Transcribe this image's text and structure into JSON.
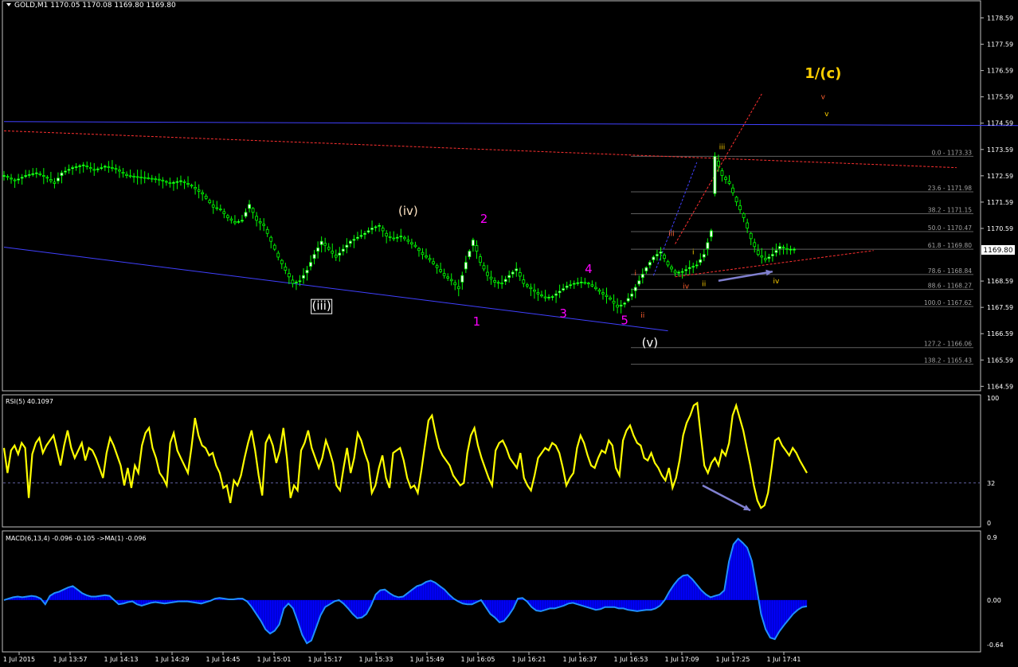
{
  "window": {
    "header": "GOLD,M1  1170.05 1170.08 1169.80 1169.80",
    "current_price": "1169.80"
  },
  "colors": {
    "background": "#000000",
    "frame": "#c0c0c0",
    "candle": "#00ff00",
    "candle_body": "#ffffff",
    "rsi": "#ffff00",
    "macd_hist": "#0000ff",
    "macd_line": "#1e90ff",
    "trend_blue": "#4040ff",
    "trend_red": "#ff3030",
    "fib": "#606060",
    "wave_magenta": "#ff00ff",
    "wave_white": "#ffffff",
    "wave_yellow": "#ffd000",
    "arrow": "#8080d0"
  },
  "chart_data": [
    {
      "type": "line",
      "title": "GOLD,M1",
      "ohlc": {
        "open": 1170.05,
        "high": 1170.08,
        "low": 1169.8,
        "close": 1169.8
      },
      "ylim": [
        1164.59,
        1178.59
      ],
      "y_ticks": [
        "1178.59",
        "1177.59",
        "1176.59",
        "1175.59",
        "1174.59",
        "1173.59",
        "1172.59",
        "1171.59",
        "1170.59",
        "1169.80",
        "1168.59",
        "1167.59",
        "1166.59",
        "1165.59",
        "1164.59"
      ],
      "x_ticks": [
        "1 Jul 2015",
        "1 Jul 13:57",
        "1 Jul 14:13",
        "1 Jul 14:29",
        "1 Jul 14:45",
        "1 Jul 15:01",
        "1 Jul 15:17",
        "1 Jul 15:33",
        "1 Jul 15:49",
        "1 Jul 16:05",
        "1 Jul 16:21",
        "1 Jul 16:37",
        "1 Jul 16:53",
        "1 Jul 17:09",
        "1 Jul 17:25",
        "1 Jul 17:41"
      ],
      "price_path": [
        [
          0,
          1172.6
        ],
        [
          3,
          1172.4
        ],
        [
          6,
          1172.6
        ],
        [
          9,
          1172.7
        ],
        [
          12,
          1172.5
        ],
        [
          14,
          1172.3
        ],
        [
          16,
          1172.7
        ],
        [
          19,
          1172.9
        ],
        [
          22,
          1173.0
        ],
        [
          25,
          1172.8
        ],
        [
          28,
          1172.95
        ],
        [
          31,
          1172.85
        ],
        [
          34,
          1172.6
        ],
        [
          37,
          1172.55
        ],
        [
          40,
          1172.5
        ],
        [
          43,
          1172.45
        ],
        [
          46,
          1172.3
        ],
        [
          49,
          1172.4
        ],
        [
          52,
          1172.2
        ],
        [
          55,
          1171.9
        ],
        [
          58,
          1171.4
        ],
        [
          60,
          1171.3
        ],
        [
          62,
          1171.0
        ],
        [
          64,
          1170.8
        ],
        [
          66,
          1170.9
        ],
        [
          68,
          1171.5
        ],
        [
          70,
          1170.9
        ],
        [
          72,
          1170.7
        ],
        [
          74,
          1170.1
        ],
        [
          76,
          1169.5
        ],
        [
          78,
          1169.0
        ],
        [
          80,
          1168.5
        ],
        [
          82,
          1168.6
        ],
        [
          84,
          1169.0
        ],
        [
          86,
          1169.6
        ],
        [
          88,
          1170.1
        ],
        [
          90,
          1169.8
        ],
        [
          92,
          1169.5
        ],
        [
          94,
          1169.8
        ],
        [
          96,
          1170.1
        ],
        [
          98,
          1170.25
        ],
        [
          100,
          1170.4
        ],
        [
          102,
          1170.6
        ],
        [
          104,
          1170.7
        ],
        [
          106,
          1170.3
        ],
        [
          108,
          1170.2
        ],
        [
          110,
          1170.3
        ],
        [
          112,
          1170.1
        ],
        [
          114,
          1169.9
        ],
        [
          116,
          1169.6
        ],
        [
          118,
          1169.4
        ],
        [
          120,
          1169.1
        ],
        [
          122,
          1168.8
        ],
        [
          124,
          1168.6
        ],
        [
          126,
          1168.3
        ],
        [
          128,
          1169.3
        ],
        [
          130,
          1170.15
        ],
        [
          132,
          1169.3
        ],
        [
          134,
          1168.8
        ],
        [
          136,
          1168.55
        ],
        [
          138,
          1168.5
        ],
        [
          140,
          1168.8
        ],
        [
          142,
          1169.05
        ],
        [
          144,
          1168.5
        ],
        [
          146,
          1168.3
        ],
        [
          148,
          1168.1
        ],
        [
          150,
          1167.95
        ],
        [
          152,
          1168.0
        ],
        [
          154,
          1168.2
        ],
        [
          156,
          1168.4
        ],
        [
          158,
          1168.5
        ],
        [
          160,
          1168.55
        ],
        [
          162,
          1168.5
        ],
        [
          164,
          1168.3
        ],
        [
          166,
          1168.1
        ],
        [
          168,
          1167.9
        ],
        [
          170,
          1167.6
        ],
        [
          172,
          1167.75
        ],
        [
          174,
          1168.1
        ],
        [
          176,
          1168.6
        ],
        [
          178,
          1169.1
        ],
        [
          180,
          1169.5
        ],
        [
          182,
          1169.7
        ],
        [
          184,
          1169.2
        ],
        [
          186,
          1168.9
        ],
        [
          188,
          1168.95
        ],
        [
          190,
          1169.1
        ],
        [
          192,
          1169.2
        ],
        [
          194,
          1169.6
        ],
        [
          196,
          1170.5
        ],
        [
          197,
          1173.33
        ],
        [
          199,
          1172.6
        ],
        [
          201,
          1172.3
        ],
        [
          203,
          1171.6
        ],
        [
          205,
          1171.0
        ],
        [
          207,
          1170.2
        ],
        [
          209,
          1169.6
        ],
        [
          211,
          1169.4
        ],
        [
          213,
          1169.6
        ],
        [
          215,
          1169.9
        ],
        [
          217,
          1169.8
        ],
        [
          219,
          1169.8
        ]
      ],
      "fib_levels": [
        {
          "label": "0.0 - 1173.33",
          "value": 1173.33
        },
        {
          "label": "23.6 - 1171.98",
          "value": 1171.98
        },
        {
          "label": "38.2 - 1171.15",
          "value": 1171.15
        },
        {
          "label": "50.0 - 1170.47",
          "value": 1170.47
        },
        {
          "label": "61.8 - 1169.80",
          "value": 1169.8
        },
        {
          "label": "78.6 - 1168.84",
          "value": 1168.84
        },
        {
          "label": "88.6 - 1168.27",
          "value": 1168.27
        },
        {
          "label": "100.0 - 1167.62",
          "value": 1167.62
        },
        {
          "label": "127.2 - 1166.06",
          "value": 1166.06
        },
        {
          "label": "138.2 - 1165.43",
          "value": 1165.43
        }
      ],
      "wave_labels": [
        {
          "text": "(iii)",
          "color": "#ffffff",
          "size": "mid",
          "boxed": true,
          "x": 88,
          "y": 1167.5
        },
        {
          "text": "(iv)",
          "color": "#ffe4c4",
          "size": "mid",
          "x": 112,
          "y": 1171.1
        },
        {
          "text": "(v)",
          "color": "#ffffff",
          "size": "mid",
          "x": 179,
          "y": 1166.1
        },
        {
          "text": "1",
          "color": "#ff00ff",
          "size": "mid",
          "x": 131,
          "y": 1166.9
        },
        {
          "text": "2",
          "color": "#ff00ff",
          "size": "mid",
          "x": 133,
          "y": 1170.8
        },
        {
          "text": "3",
          "color": "#ff00ff",
          "size": "mid",
          "x": 155,
          "y": 1167.2
        },
        {
          "text": "4",
          "color": "#ff00ff",
          "size": "mid",
          "x": 162,
          "y": 1168.9
        },
        {
          "text": "5",
          "color": "#ff00ff",
          "size": "mid",
          "x": 172,
          "y": 1166.95
        },
        {
          "text": "1/(c)",
          "color": "#ffd000",
          "size": "big",
          "x": 227,
          "y": 1176.3
        },
        {
          "text": "i",
          "color": "#ff6030",
          "size": "small",
          "x": 175,
          "y": 1168.8
        },
        {
          "text": "ii",
          "color": "#ff6030",
          "size": "small",
          "x": 177,
          "y": 1167.2
        },
        {
          "text": "iii",
          "color": "#ff6030",
          "size": "small",
          "x": 185,
          "y": 1170.3
        },
        {
          "text": "iv",
          "color": "#ff6030",
          "size": "small",
          "x": 189,
          "y": 1168.3
        },
        {
          "text": "i",
          "color": "#ffd000",
          "size": "small",
          "x": 191,
          "y": 1169.6
        },
        {
          "text": "ii",
          "color": "#ffd000",
          "size": "small",
          "x": 194,
          "y": 1168.4
        },
        {
          "text": "iii",
          "color": "#ffd000",
          "size": "small",
          "x": 199,
          "y": 1173.6
        },
        {
          "text": "iv",
          "color": "#ffd000",
          "size": "small",
          "x": 214,
          "y": 1168.5
        },
        {
          "text": "v",
          "color": "#ff6030",
          "size": "small",
          "x": 227,
          "y": 1175.5
        },
        {
          "text": "v",
          "color": "#ffd000",
          "size": "small",
          "x": 228,
          "y": 1174.85
        }
      ],
      "lines": [
        {
          "name": "horizontal-resistance",
          "color": "#4040ff",
          "dash": false,
          "from": [
            0,
            1174.65
          ],
          "to": [
            281,
            1174.5
          ]
        },
        {
          "name": "lower-channel",
          "color": "#4040ff",
          "dash": false,
          "from": [
            0,
            1169.88
          ],
          "to": [
            184,
            1166.7
          ]
        },
        {
          "name": "red-downtrend",
          "color": "#ff3030",
          "dash": true,
          "from": [
            0,
            1174.3
          ],
          "to": [
            264,
            1172.9
          ]
        },
        {
          "name": "red-rising-support",
          "color": "#ff3030",
          "dash": true,
          "from": [
            186,
            1168.75
          ],
          "to": [
            241,
            1169.75
          ]
        },
        {
          "name": "red-steep-channel",
          "color": "#ff3030",
          "dash": true,
          "from": [
            186,
            1170.0
          ],
          "to": [
            210,
            1175.7
          ]
        },
        {
          "name": "blue-steep-channel",
          "color": "#4040ff",
          "dash": true,
          "from": [
            180,
            1168.8
          ],
          "to": [
            192,
            1173.1
          ]
        }
      ],
      "arrows": [
        {
          "name": "price-divergence-arrow",
          "from": [
            198,
            1168.6
          ],
          "to": [
            213,
            1168.95
          ]
        }
      ]
    },
    {
      "type": "line",
      "title": "RSI(5) 40.1097",
      "ylim": [
        0,
        100
      ],
      "y_ticks": [
        "100",
        "32",
        "0"
      ],
      "level_line": 32,
      "values": [
        60,
        40,
        58,
        62,
        55,
        64,
        60,
        20,
        55,
        64,
        68,
        56,
        62,
        66,
        70,
        58,
        46,
        62,
        74,
        60,
        52,
        58,
        64,
        50,
        60,
        58,
        52,
        44,
        36,
        56,
        68,
        62,
        54,
        46,
        30,
        44,
        28,
        46,
        40,
        62,
        72,
        76,
        60,
        52,
        40,
        36,
        30,
        64,
        72,
        58,
        52,
        46,
        40,
        60,
        84,
        70,
        62,
        60,
        54,
        56,
        46,
        40,
        28,
        30,
        16,
        34,
        30,
        38,
        52,
        64,
        74,
        58,
        38,
        22,
        64,
        70,
        62,
        48,
        58,
        76,
        52,
        20,
        30,
        26,
        58,
        64,
        74,
        60,
        52,
        44,
        52,
        66,
        58,
        48,
        30,
        26,
        44,
        60,
        40,
        52,
        72,
        66,
        56,
        48,
        24,
        30,
        44,
        54,
        36,
        28,
        56,
        58,
        60,
        50,
        36,
        28,
        30,
        24,
        42,
        62,
        82,
        86,
        72,
        60,
        54,
        50,
        46,
        38,
        34,
        30,
        32,
        56,
        70,
        76,
        62,
        52,
        44,
        36,
        30,
        58,
        64,
        66,
        60,
        52,
        48,
        44,
        56,
        36,
        30,
        26,
        38,
        52,
        56,
        60,
        58,
        64,
        62,
        56,
        44,
        30,
        36,
        40,
        60,
        70,
        64,
        54,
        46,
        44,
        52,
        58,
        56,
        66,
        62,
        44,
        38,
        66,
        74,
        78,
        70,
        64,
        62,
        52,
        50,
        56,
        48,
        44,
        38,
        34,
        44,
        28,
        36,
        50,
        70,
        80,
        86,
        94,
        96,
        70,
        46,
        40,
        48,
        52,
        46,
        58,
        54,
        64,
        86,
        94,
        84,
        74,
        60,
        46,
        30,
        18,
        12,
        14,
        24,
        44,
        66,
        68,
        62,
        58,
        54,
        60,
        56,
        50,
        45,
        40
      ]
    },
    {
      "type": "area",
      "title": "MACD(6,13,4) -0.096 -0.105  ->MA(1) -0.096",
      "ylim": [
        -0.64,
        0.9
      ],
      "y_ticks": [
        "0.9",
        "0.00",
        "-0.64"
      ],
      "values": [
        0.0,
        0.02,
        0.04,
        0.05,
        0.04,
        0.05,
        0.06,
        0.05,
        0.02,
        -0.06,
        0.06,
        0.1,
        0.12,
        0.15,
        0.18,
        0.2,
        0.15,
        0.1,
        0.07,
        0.05,
        0.05,
        0.06,
        0.07,
        0.06,
        0.0,
        -0.06,
        -0.05,
        -0.03,
        -0.02,
        -0.06,
        -0.08,
        -0.06,
        -0.04,
        -0.03,
        -0.04,
        -0.05,
        -0.04,
        -0.03,
        -0.02,
        -0.02,
        -0.02,
        -0.03,
        -0.04,
        -0.05,
        -0.03,
        -0.01,
        0.02,
        0.03,
        0.02,
        0.01,
        0.01,
        0.02,
        0.02,
        -0.02,
        -0.1,
        -0.2,
        -0.3,
        -0.42,
        -0.48,
        -0.44,
        -0.35,
        -0.12,
        -0.05,
        -0.12,
        -0.3,
        -0.5,
        -0.62,
        -0.58,
        -0.4,
        -0.22,
        -0.1,
        -0.06,
        -0.02,
        0.0,
        -0.05,
        -0.12,
        -0.2,
        -0.26,
        -0.25,
        -0.2,
        -0.08,
        0.08,
        0.14,
        0.15,
        0.1,
        0.06,
        0.04,
        0.05,
        0.1,
        0.15,
        0.2,
        0.22,
        0.26,
        0.28,
        0.25,
        0.2,
        0.15,
        0.08,
        0.02,
        -0.02,
        -0.05,
        -0.06,
        -0.06,
        -0.03,
        0.0,
        -0.1,
        -0.2,
        -0.25,
        -0.32,
        -0.3,
        -0.22,
        -0.12,
        0.02,
        0.03,
        -0.02,
        -0.1,
        -0.15,
        -0.16,
        -0.14,
        -0.12,
        -0.12,
        -0.1,
        -0.08,
        -0.05,
        -0.04,
        -0.06,
        -0.08,
        -0.1,
        -0.12,
        -0.14,
        -0.13,
        -0.1,
        -0.1,
        -0.1,
        -0.12,
        -0.12,
        -0.14,
        -0.15,
        -0.16,
        -0.15,
        -0.14,
        -0.14,
        -0.12,
        -0.08,
        0.0,
        0.12,
        0.22,
        0.3,
        0.35,
        0.36,
        0.3,
        0.22,
        0.14,
        0.08,
        0.04,
        0.06,
        0.08,
        0.14,
        0.55,
        0.8,
        0.88,
        0.82,
        0.75,
        0.56,
        0.2,
        -0.2,
        -0.42,
        -0.54,
        -0.56,
        -0.45,
        -0.36,
        -0.28,
        -0.2,
        -0.14,
        -0.1,
        -0.09
      ]
    }
  ]
}
